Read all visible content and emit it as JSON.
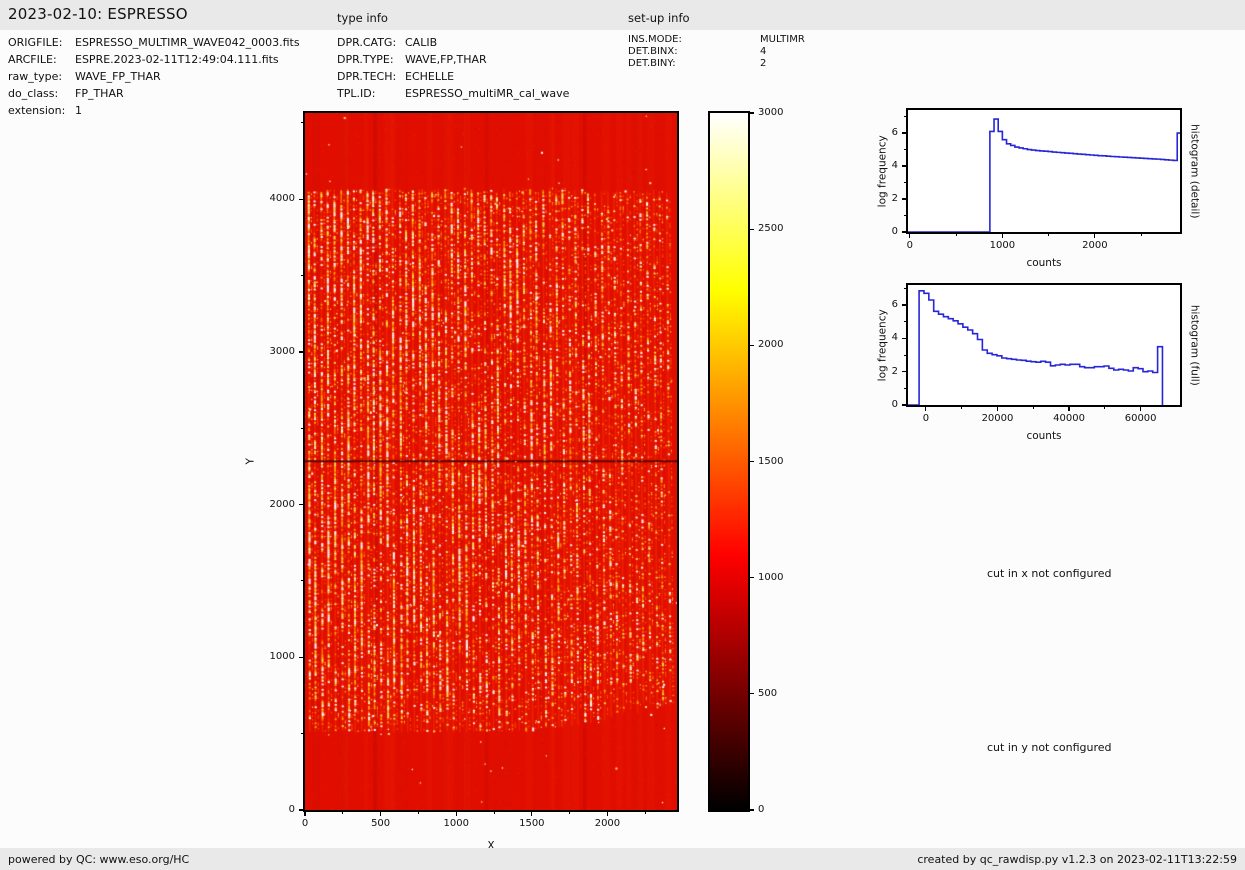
{
  "header": {
    "title": "2023-02-10: ESPRESSO",
    "type_info_heading": "type info",
    "setup_info_heading": "set-up info"
  },
  "file_info": {
    "rows": [
      {
        "label": "ORIGFILE:",
        "value": "ESPRESSO_MULTIMR_WAVE042_0003.fits"
      },
      {
        "label": "ARCFILE:",
        "value": "ESPRE.2023-02-11T12:49:04.111.fits"
      },
      {
        "label": "raw_type:",
        "value": "WAVE_FP_THAR"
      },
      {
        "label": "do_class:",
        "value": "FP_THAR"
      },
      {
        "label": "extension:",
        "value": "1"
      }
    ]
  },
  "type_info": {
    "rows": [
      {
        "label": "DPR.CATG:",
        "value": "CALIB"
      },
      {
        "label": "DPR.TYPE:",
        "value": "WAVE,FP,THAR"
      },
      {
        "label": "DPR.TECH:",
        "value": "ECHELLE"
      },
      {
        "label": "TPL.ID:",
        "value": "ESPRESSO_multiMR_cal_wave"
      }
    ]
  },
  "setup_info": {
    "rows": [
      {
        "label": "INS.MODE:",
        "value": "MULTIMR"
      },
      {
        "label": "DET.BINX:",
        "value": "4"
      },
      {
        "label": "DET.BINY:",
        "value": "2"
      }
    ]
  },
  "messages": {
    "cut_x": "cut in x not configured",
    "cut_y": "cut in y not configured"
  },
  "footer": {
    "left": "powered by QC: www.eso.org/HC",
    "right": "created by qc_rawdisp.py v1.2.3 on 2023-02-11T13:22:59"
  },
  "colors": {
    "hist_line": "#2626d8",
    "image_background_red": "#e10e00",
    "bar_background": "#e9e9e9",
    "axis_black": "#000000"
  },
  "chart_data": [
    {
      "id": "raw_frame_image",
      "type": "heatmap",
      "title": "",
      "xlabel": "X",
      "ylabel": "Y",
      "xlim": [
        0,
        2460
      ],
      "ylim": [
        0,
        4565
      ],
      "x_ticks": [
        0,
        500,
        1000,
        1500,
        2000
      ],
      "x_minor_ticks": [
        250,
        750,
        1250,
        1750,
        2250
      ],
      "y_ticks": [
        0,
        1000,
        2000,
        3000,
        4000
      ],
      "y_minor_ticks": [
        500,
        1500,
        2500,
        3500,
        4500
      ],
      "colormap": "hot",
      "description": "raw echelle calibration frame: red background ~1000 counts with ~56 vertical speckled FP/ThAr fiber orders",
      "procedural": {
        "seed": 20230210,
        "stripe_count": 56,
        "stripe_y_bottom": 520,
        "stripe_y_top": 4060,
        "bottom_rise_start_x": 1250,
        "bottom_rise_amount": 240,
        "detector_gap_line_y": 2290,
        "background_counts": 1000
      }
    },
    {
      "id": "colorbar",
      "type": "colorbar",
      "vmin": 0,
      "vmax": 3000,
      "ticks": [
        0,
        500,
        1000,
        1500,
        2000,
        2500,
        3000
      ],
      "colormap": "hot",
      "gradient_stops": [
        [
          0,
          "#000000"
        ],
        [
          36.5,
          "#ff0000"
        ],
        [
          74.6,
          "#ffff00"
        ],
        [
          100,
          "#ffffff"
        ]
      ]
    },
    {
      "id": "histogram_detail",
      "type": "histogram-step",
      "xlabel": "counts",
      "ylabel": "log frequency",
      "side_label": "histogram (detail)",
      "xlim": [
        -20,
        2920
      ],
      "ylim": [
        0,
        7.4
      ],
      "x_ticks": [
        0,
        1000,
        2000
      ],
      "x_minor_ticks": [
        500,
        1500,
        2500
      ],
      "y_ticks": [
        0,
        2,
        4,
        6
      ],
      "y_minor_ticks": [
        1,
        3,
        5,
        7
      ],
      "bin_start": 865,
      "bin_width": 45,
      "baseline_from": -20,
      "values": [
        6.1,
        6.85,
        6.1,
        5.6,
        5.35,
        5.25,
        5.15,
        5.1,
        5.05,
        5.0,
        4.97,
        4.94,
        4.92,
        4.9,
        4.88,
        4.85,
        4.83,
        4.81,
        4.79,
        4.77,
        4.75,
        4.73,
        4.71,
        4.69,
        4.67,
        4.65,
        4.63,
        4.62,
        4.6,
        4.58,
        4.57,
        4.55,
        4.54,
        4.52,
        4.51,
        4.49,
        4.48,
        4.46,
        4.45,
        4.43,
        4.42,
        4.4,
        4.38,
        4.36,
        4.34,
        6.0
      ]
    },
    {
      "id": "histogram_full",
      "type": "histogram-step",
      "xlabel": "counts",
      "ylabel": "log frequency",
      "side_label": "histogram (full)",
      "xlim": [
        -5000,
        71000
      ],
      "ylim": [
        0,
        7.2
      ],
      "x_ticks": [
        0,
        20000,
        40000,
        60000
      ],
      "x_minor_ticks": [
        10000,
        30000,
        50000
      ],
      "y_ticks": [
        0,
        2,
        4,
        6
      ],
      "y_minor_ticks": [
        1,
        3,
        5,
        7
      ],
      "bin_start": -1900,
      "bin_width": 1360,
      "baseline_from": -5000,
      "values": [
        6.85,
        6.7,
        6.3,
        5.62,
        5.45,
        5.3,
        5.18,
        5.05,
        4.87,
        4.67,
        4.5,
        4.28,
        3.93,
        3.3,
        3.1,
        3.02,
        2.95,
        2.82,
        2.78,
        2.74,
        2.7,
        2.68,
        2.63,
        2.6,
        2.57,
        2.62,
        2.57,
        2.35,
        2.4,
        2.44,
        2.4,
        2.44,
        2.44,
        2.3,
        2.24,
        2.24,
        2.3,
        2.3,
        2.34,
        2.2,
        2.1,
        2.14,
        2.1,
        2.04,
        2.24,
        2.18,
        2.0,
        2.04,
        1.95,
        3.5
      ]
    }
  ]
}
